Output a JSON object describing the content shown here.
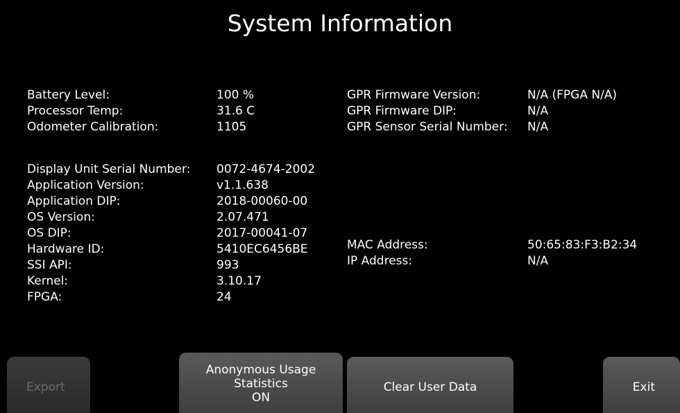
{
  "title": "System Information",
  "left_block_1": [
    {
      "label": "Battery Level:",
      "value": "100 %"
    },
    {
      "label": "Processor Temp:",
      "value": "31.6 C"
    },
    {
      "label": "Odometer Calibration:",
      "value": "1105"
    }
  ],
  "left_block_2": [
    {
      "label": "Display Unit Serial Number:",
      "value": "0072-4674-2002"
    },
    {
      "label": "Application Version:",
      "value": "v1.1.638"
    },
    {
      "label": "Application DIP:",
      "value": "2018-00060-00"
    },
    {
      "label": "OS Version:",
      "value": "2.07.471"
    },
    {
      "label": "OS DIP:",
      "value": "2017-00041-07"
    },
    {
      "label": "Hardware ID:",
      "value": "5410EC6456BE"
    },
    {
      "label": "SSI API:",
      "value": "993"
    },
    {
      "label": "Kernel:",
      "value": "3.10.17"
    },
    {
      "label": "FPGA:",
      "value": "24"
    }
  ],
  "right_block_1": [
    {
      "label": "GPR Firmware Version:",
      "value": "N/A (FPGA N/A)"
    },
    {
      "label": "GPR Firmware DIP:",
      "value": "N/A"
    },
    {
      "label": "GPR Sensor Serial Number:",
      "value": "N/A"
    }
  ],
  "right_block_2": [
    {
      "label": "MAC Address:",
      "value": "50:65:83:F3:B2:34"
    },
    {
      "label": "IP Address:",
      "value": "N/A"
    }
  ],
  "buttons": {
    "export": "Export",
    "usage_line1": "Anonymous Usage",
    "usage_line2": "Statistics",
    "usage_line3": "ON",
    "clear": "Clear User Data",
    "exit": "Exit"
  }
}
